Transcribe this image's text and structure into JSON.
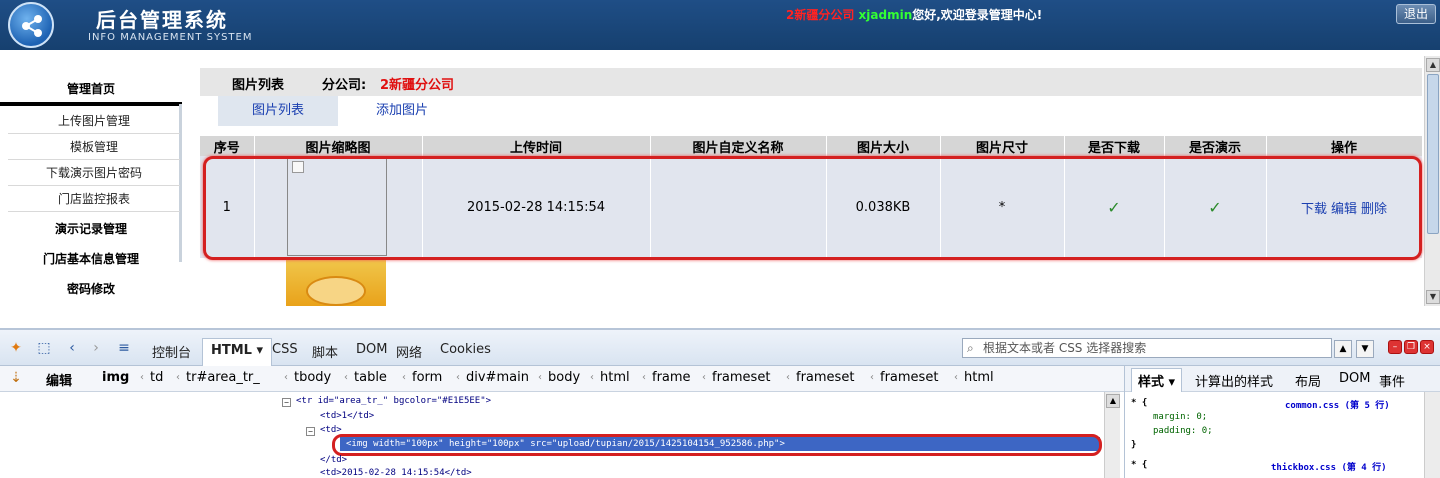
{
  "header": {
    "title": "后台管理系统",
    "subtitle": "INFO MANAGEMENT SYSTEM",
    "welcome_branch": "2新疆分公司",
    "welcome_user": "xjadmin",
    "welcome_text": "您好,欢迎登录管理中心!",
    "logout_label": "退出"
  },
  "sidebar": {
    "home": "管理首页",
    "items": [
      "上传图片管理",
      "模板管理",
      "下载演示图片密码",
      "门店监控报表"
    ],
    "demo_records": "演示记录管理",
    "store_info": "门店基本信息管理",
    "password": "密码修改"
  },
  "main": {
    "crumb_label": "图片列表",
    "crumb_branch_label": "分公司:",
    "crumb_branch": "2新疆分公司",
    "tabs": [
      "图片列表",
      "添加图片"
    ]
  },
  "table": {
    "headers": [
      "序号",
      "图片缩略图",
      "上传时间",
      "图片自定义名称",
      "图片大小",
      "图片尺寸",
      "是否下载",
      "是否演示",
      "操作"
    ],
    "rows": [
      {
        "index": "1",
        "upload_time": "2015-02-28 14:15:54",
        "custom_name": "",
        "size": "0.038KB",
        "dimensions": "*",
        "downloaded": "✓",
        "demo": "✓",
        "ops": [
          "下载",
          "编辑",
          "删除"
        ]
      }
    ]
  },
  "firebug": {
    "tabs": [
      "控制台",
      "HTML",
      "CSS",
      "脚本",
      "DOM",
      "网络",
      "Cookies"
    ],
    "search_placeholder": "根据文本或者 CSS 选择器搜索",
    "edit_label": "编辑",
    "breadcrumbs": [
      "img",
      "td",
      "tr#area_tr_",
      "tbody",
      "table",
      "form",
      "div#main",
      "body",
      "html",
      "frame",
      "frameset",
      "frameset",
      "frameset",
      "html"
    ],
    "code": {
      "line1_tag": "<tr id=\"area_tr_\" bgcolor=\"#E1E5EE\">",
      "line2": "<td>1</td>",
      "line3": "<td>",
      "selected": "<img width=\"100px\" height=\"100px\" src=\"upload/tupian/2015/1425104154_952586.php\">",
      "line5": "</td>",
      "line6": "<td>2015-02-28 14:15:54</td>"
    },
    "side_tabs": [
      "样式",
      "计算出的样式",
      "布局",
      "DOM",
      "事件"
    ],
    "side_code": {
      "rule1_selector": "* {",
      "rule1_src": "common.css (第 5 行)",
      "rule1_prop1": "margin: 0;",
      "rule1_prop2": "padding: 0;",
      "rule1_close": "}",
      "rule2_selector": "* {",
      "rule2_src": "thickbox.css (第 4 行)"
    }
  },
  "colors": {
    "header_bg": "#1f4e86",
    "row_bg": "#E1E5EE",
    "highlight": "#d42020",
    "link": "#1a3fb0"
  }
}
